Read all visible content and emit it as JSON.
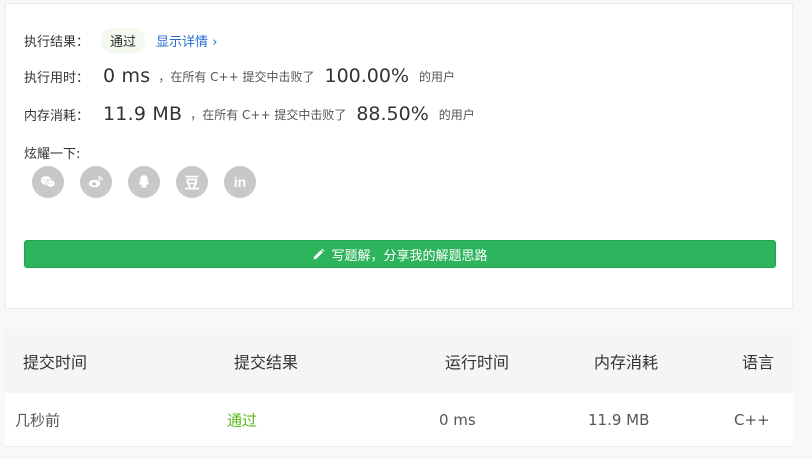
{
  "result": {
    "label": "执行结果：",
    "status": "通过",
    "details_link": "显示详情",
    "details_chevron": "›"
  },
  "runtime": {
    "label": "执行用时：",
    "value": "0 ms",
    "text_before": "，在所有 C++ 提交中击败了",
    "percent": "100.00%",
    "text_after": "的用户"
  },
  "memory": {
    "label": "内存消耗：",
    "value": "11.9 MB",
    "text_before": "，在所有 C++ 提交中击败了",
    "percent": "88.50%",
    "text_after": "的用户"
  },
  "share": {
    "label": "炫耀一下:",
    "icons": [
      "wechat-icon",
      "weibo-icon",
      "qq-icon",
      "douban-icon",
      "linkedin-icon"
    ],
    "douban_glyph": "豆",
    "linkedin_glyph": "in"
  },
  "write_button": {
    "label": "写题解，分享我的解题思路"
  },
  "table": {
    "headers": [
      "提交时间",
      "提交结果",
      "运行时间",
      "内存消耗",
      "语言"
    ],
    "rows": [
      [
        "几秒前",
        "通过",
        "0 ms",
        "11.9 MB",
        "C++"
      ]
    ]
  },
  "colors": {
    "accent_green": "#2db55d",
    "status_green": "#5cb819",
    "link_blue": "#246bd1",
    "icon_gray": "#c8c8c8"
  }
}
